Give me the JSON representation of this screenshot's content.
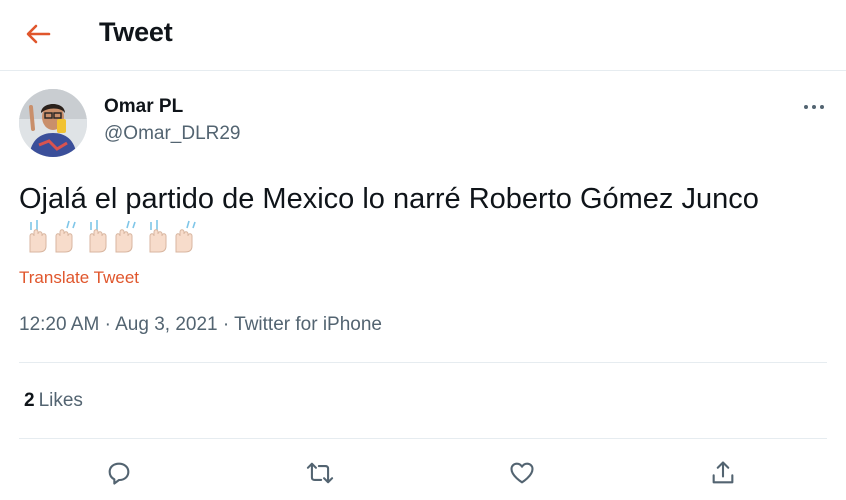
{
  "header": {
    "title": "Tweet",
    "back_icon": "arrow-left-icon",
    "accent": "#e0562c"
  },
  "tweet": {
    "author_name": "Omar PL",
    "author_handle": "@Omar_DLR29",
    "text": "Ojalá el partido de Mexico lo narré Roberto Gómez Junco",
    "emoji": "🙌🏻🙌🏻🙌🏻",
    "translate_label": "Translate Tweet",
    "time": "12:20 AM",
    "date": "Aug 3, 2021",
    "source": "Twitter for iPhone",
    "separator": "·",
    "likes_count": "2",
    "likes_label": "Likes"
  },
  "actions": {
    "reply_icon": "reply-icon",
    "retweet_icon": "retweet-icon",
    "like_icon": "heart-icon",
    "share_icon": "share-icon"
  },
  "colors": {
    "text": "#0f1419",
    "muted": "#536471",
    "divider": "#e6ecf0"
  }
}
